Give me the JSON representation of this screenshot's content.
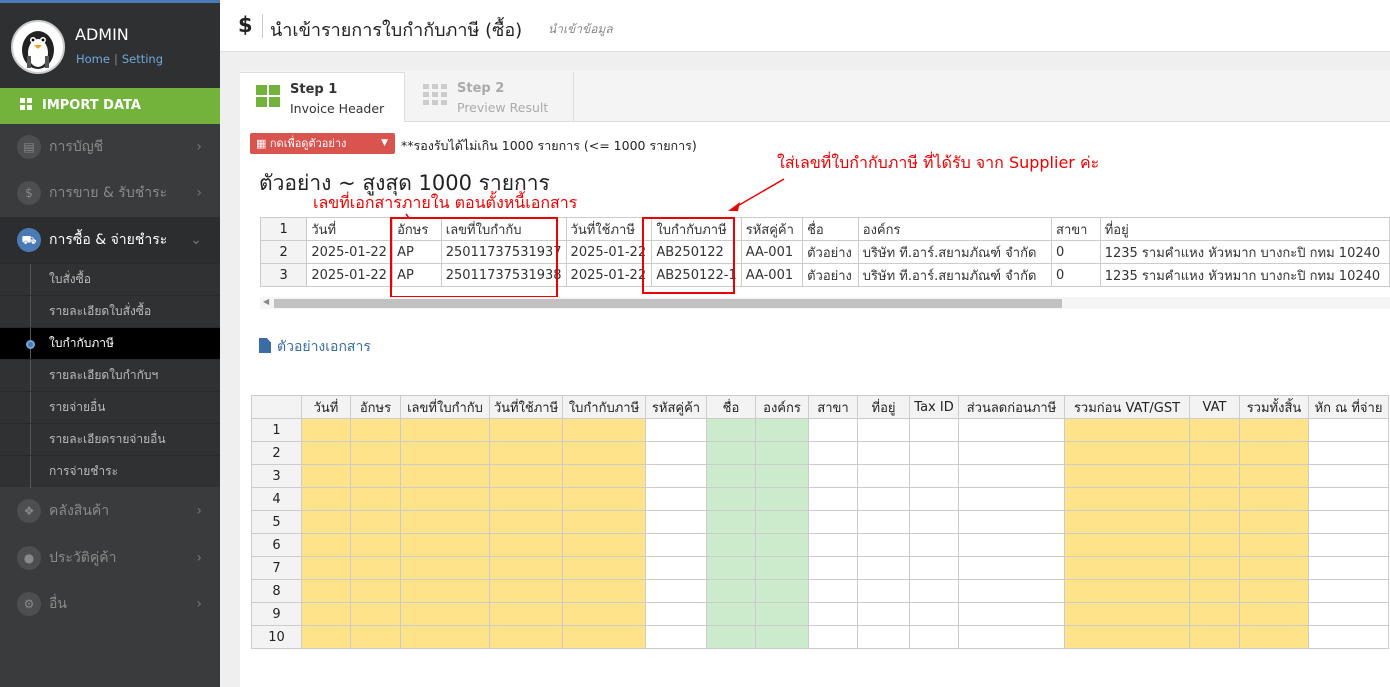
{
  "sidebar": {
    "user_name": "ADMIN",
    "link_home": "Home",
    "link_sep": "|",
    "link_setting": "Setting",
    "import_label": "IMPORT DATA",
    "menu": [
      {
        "label": "การบัญชี",
        "icon": "book-icon"
      },
      {
        "label": "การขาย & รับชำระ",
        "icon": "dollar-icon"
      },
      {
        "label": "การซื้อ & จ่ายชำระ",
        "icon": "cart-icon"
      },
      {
        "label": "คลังสินค้า",
        "icon": "cubes-icon"
      },
      {
        "label": "ประวัติคู่ค้า",
        "icon": "user-icon"
      },
      {
        "label": "อื่น",
        "icon": "gear-icon"
      }
    ],
    "submenu": [
      "ใบสั่งซื้อ",
      "รายละเอียดใบสั่งซื้อ",
      "ใบกำกับภาษี",
      "รายละเอียดใบกำกับฯ",
      "รายจ่ายอื่น",
      "รายละเอียดรายจ่ายอื่น",
      "การจ่ายชำระ"
    ]
  },
  "header": {
    "icon_symbol": "$",
    "title": "นำเข้ารายการใบกำกับภาษี (ซื้อ)",
    "subtitle": "นำเข้าข้อมูล"
  },
  "wizard": {
    "step1_title": "Step 1",
    "step1_sub": "Invoice Header",
    "step2_title": "Step 2",
    "step2_sub": "Preview Result"
  },
  "example_button": "กดเพื่อดูตัวอย่าง",
  "limit_note": "**รองรับได้ไม่เกิน 1000 รายการ (<= 1000 รายการ)",
  "sample_title": "ตัวอย่าง ~ สูงสุด 1000 รายการ",
  "annotation_supplier": "ใส่เลขที่ใบกำกับภาษี ที่ได้รับ จาก Supplier ค่ะ",
  "annotation_internal": "เลขที่เอกสารภายใน ตอนตั้งหนี้เอกสาร",
  "sample_table": {
    "rows": [
      [
        "1",
        "วันที่",
        "อักษร",
        "เลขที่ใบกำกับ",
        "วันที่ใช้ภาษี",
        "ใบกำกับภาษี",
        "รหัสคู่ค้า",
        "ชื่อ",
        "องค์กร",
        "สาขา",
        "ที่อยู่"
      ],
      [
        "2",
        "2025-01-22",
        "AP",
        "25011737531937",
        "2025-01-22",
        "AB250122",
        "AA-001",
        "ตัวอย่าง",
        "บริษัท ที.อาร์.สยามภัณฑ์ จำกัด",
        "0",
        "1235 รามคำแหง หัวหมาก บางกะปิ กทม 10240"
      ],
      [
        "3",
        "2025-01-22",
        "AP",
        "25011737531938",
        "2025-01-22",
        "AB250122-1",
        "AA-001",
        "ตัวอย่าง",
        "บริษัท ที.อาร์.สยามภัณฑ์ จำกัด",
        "0",
        "1235 รามคำแหง หัวหมาก บางกะปิ กทม 10240"
      ]
    ]
  },
  "doc_link": "ตัวอย่างเอกสาร",
  "grid": {
    "headers": [
      "วันที่",
      "อักษร",
      "เลขที่ใบกำกับ",
      "วันที่ใช้ภาษี",
      "ใบกำกับภาษี",
      "รหัสคู่ค้า",
      "ชื่อ",
      "องค์กร",
      "สาขา",
      "ที่อยู่",
      "Tax ID",
      "ส่วนลดก่อนภาษี",
      "รวมก่อน VAT/GST",
      "VAT",
      "รวมทั้งสิ้น",
      "หัก ณ ที่จ่าย"
    ],
    "row_numbers": [
      "1",
      "2",
      "3",
      "4",
      "5",
      "6",
      "7",
      "8",
      "9",
      "10"
    ]
  },
  "colors": {
    "accent_green": "#73b33b",
    "accent_blue": "#4a7ab5",
    "annotation_red": "#e00000",
    "cell_yellow": "#ffe38a",
    "cell_green": "#ccebcc"
  }
}
